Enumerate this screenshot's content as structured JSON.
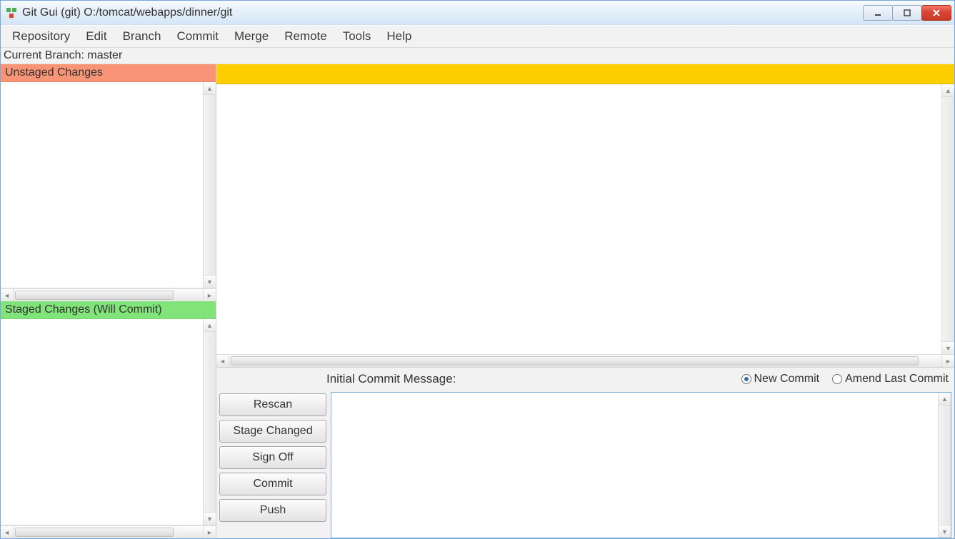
{
  "window": {
    "title": "Git Gui (git) O:/tomcat/webapps/dinner/git"
  },
  "menu": {
    "items": [
      "Repository",
      "Edit",
      "Branch",
      "Commit",
      "Merge",
      "Remote",
      "Tools",
      "Help"
    ]
  },
  "status": {
    "branch_label": "Current Branch: master"
  },
  "panels": {
    "unstaged_header": "Unstaged Changes",
    "staged_header": "Staged Changes (Will Commit)"
  },
  "commit": {
    "prompt_label": "Initial Commit Message:",
    "radio_new": "New Commit",
    "radio_amend": "Amend Last Commit",
    "radio_selected": "new",
    "message_value": ""
  },
  "buttons": {
    "rescan": "Rescan",
    "stage_changed": "Stage Changed",
    "sign_off": "Sign Off",
    "commit": "Commit",
    "push": "Push"
  }
}
